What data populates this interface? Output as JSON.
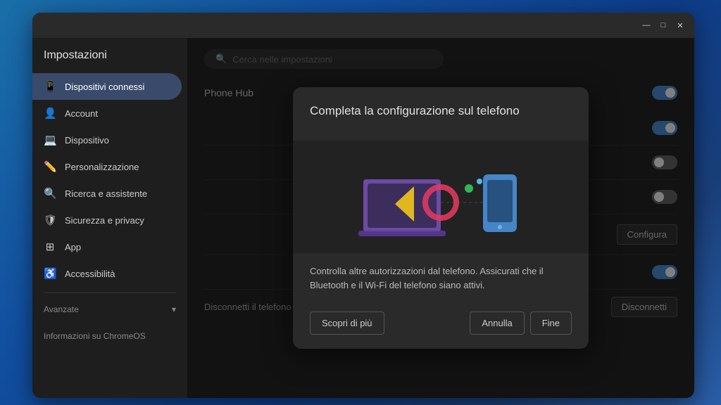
{
  "window": {
    "title": "Impostazioni"
  },
  "titlebar": {
    "minimize": "—",
    "maximize": "□",
    "close": "✕"
  },
  "sidebar": {
    "title": "Impostazioni",
    "search_placeholder": "Cerca nelle impostazioni",
    "items": [
      {
        "id": "dispositivi-connessi",
        "label": "Dispositivi connessi",
        "icon": "📱",
        "active": true
      },
      {
        "id": "account",
        "label": "Account",
        "icon": "👤",
        "active": false
      },
      {
        "id": "dispositivo",
        "label": "Dispositivo",
        "icon": "💻",
        "active": false
      },
      {
        "id": "personalizzazione",
        "label": "Personalizzazione",
        "icon": "✏️",
        "active": false
      },
      {
        "id": "ricerca-assistente",
        "label": "Ricerca e assistente",
        "icon": "🔍",
        "active": false
      },
      {
        "id": "sicurezza-privacy",
        "label": "Sicurezza e privacy",
        "icon": "🛡",
        "active": false
      },
      {
        "id": "app",
        "label": "App",
        "icon": "⊞",
        "active": false
      },
      {
        "id": "accessibilita",
        "label": "Accessibilità",
        "icon": "♿",
        "active": false
      }
    ],
    "avanzate": "Avanzate",
    "informazioni": "Informazioni su ChromeOS"
  },
  "content": {
    "phone_hub_label": "Phone Hub",
    "configure_label": "Configura",
    "disconnect_label": "Disconnetti il telefono da Chromebook",
    "disconnect_btn": "Disconnetti"
  },
  "dialog": {
    "title": "Completa la configurazione sul telefono",
    "body": "Controlla altre autorizzazioni dal telefono. Assicurati che il Bluetooth e il Wi-Fi del telefono siano attivi.",
    "btn_scopri": "Scopri di più",
    "btn_annulla": "Annulla",
    "btn_fine": "Fine"
  }
}
